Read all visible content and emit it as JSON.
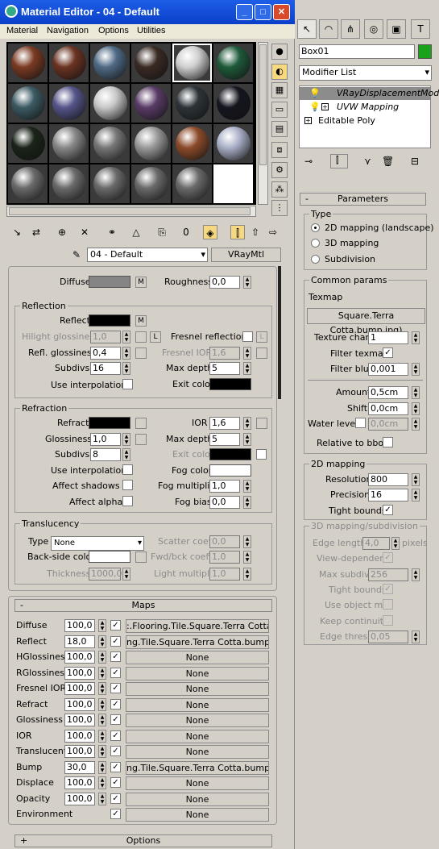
{
  "window": {
    "title": "Material Editor - 04 - Default",
    "minimize": "_",
    "maximize": "□",
    "close": "✕"
  },
  "menu": [
    "Material",
    "Navigation",
    "Options",
    "Utilities"
  ],
  "colors": {
    "title_blue": "#0a3fc9",
    "object_color": "#1aa31a",
    "selected_modifier": "#8c8c8c"
  },
  "slot_balls": [
    "#7a3a22",
    "#6b3322",
    "#4f6a85",
    "#3a2a24",
    "#cfcfcf",
    "#1e5a3a",
    "#3c5a63",
    "#55558a",
    "#c8c8c8",
    "#5a3b66",
    "#2c3438",
    "#15151f",
    "#1a2418",
    "#888888",
    "#777777",
    "#9a9a9a",
    "#8c4a2a",
    "#aab0c8",
    "#6a6a6a",
    "#6a6a6a",
    "#6a6a6a",
    "#6a6a6a",
    "#6a6a6a",
    "#ffffff"
  ],
  "material_name": "04 - Default",
  "material_type": "VRayMtl",
  "basic": {
    "diffuse": "Diffuse",
    "diffuse_btn": "M",
    "roughness": "Roughness",
    "roughness_val": "0,0"
  },
  "reflection": {
    "title": "Reflection",
    "reflect": "Reflect",
    "reflect_btn": "M",
    "hilight": "Hilight glossiness",
    "hilight_val": "1,0",
    "hilight_lock": "L",
    "fresnel": "Fresnel reflections",
    "fresnel_lock": "L",
    "refl_gloss": "Refl. glossiness",
    "refl_gloss_val": "0,4",
    "fresnel_ior": "Fresnel IOR",
    "fresnel_ior_val": "1,6",
    "subdivs": "Subdivs",
    "subdivs_val": "16",
    "max_depth": "Max depth",
    "max_depth_val": "5",
    "use_interp": "Use interpolation",
    "exit_color": "Exit color"
  },
  "refraction": {
    "title": "Refraction",
    "refract": "Refract",
    "ior": "IOR",
    "ior_val": "1,6",
    "glossiness": "Glossiness",
    "glossiness_val": "1,0",
    "max_depth": "Max depth",
    "max_depth_val": "5",
    "subdivs": "Subdivs",
    "subdivs_val": "8",
    "exit_color": "Exit color",
    "use_interp": "Use interpolation",
    "fog_color": "Fog color",
    "affect_shadows": "Affect shadows",
    "fog_mult": "Fog multiplier",
    "fog_mult_val": "1,0",
    "affect_alpha": "Affect alpha",
    "fog_bias": "Fog bias",
    "fog_bias_val": "0,0"
  },
  "translucency": {
    "title": "Translucency",
    "type": "Type",
    "type_val": "None",
    "scatter": "Scatter coeff",
    "scatter_val": "0,0",
    "backside": "Back-side color",
    "fwd": "Fwd/bck coeff",
    "fwd_val": "1,0",
    "thickness": "Thickness",
    "thickness_val": "1000,0",
    "light_mult": "Light multiplier",
    "light_mult_val": "1,0"
  },
  "maps": {
    "title": "Maps",
    "minus": "-",
    "rows": [
      {
        "name": "Diffuse",
        "amount": "100,0",
        "map": ":.Flooring.Tile.Square.Terra Cotta.jpg)"
      },
      {
        "name": "Reflect",
        "amount": "18,0",
        "map": "ng.Tile.Square.Terra Cotta.bump.jpg)"
      },
      {
        "name": "HGlossiness",
        "amount": "100,0",
        "map": "None"
      },
      {
        "name": "RGlossiness",
        "amount": "100,0",
        "map": "None"
      },
      {
        "name": "Fresnel IOR",
        "amount": "100,0",
        "map": "None"
      },
      {
        "name": "Refract",
        "amount": "100,0",
        "map": "None"
      },
      {
        "name": "Glossiness",
        "amount": "100,0",
        "map": "None"
      },
      {
        "name": "IOR",
        "amount": "100,0",
        "map": "None"
      },
      {
        "name": "Translucent",
        "amount": "100,0",
        "map": "None"
      },
      {
        "name": "Bump",
        "amount": "30,0",
        "map": "ng.Tile.Square.Terra Cotta.bump.jpg)"
      },
      {
        "name": "Displace",
        "amount": "100,0",
        "map": "None"
      },
      {
        "name": "Opacity",
        "amount": "100,0",
        "map": "None"
      },
      {
        "name": "Environment",
        "amount": "",
        "map": "None"
      }
    ]
  },
  "options": {
    "title": "Options",
    "plus": "+"
  },
  "cmd": {
    "object_name": "Box01",
    "modifier_list": "Modifier List",
    "stack": [
      "VRayDisplacementMod",
      "UVW Mapping",
      "Editable Poly"
    ],
    "params_title": "Parameters",
    "params_minus": "-",
    "type_title": "Type",
    "type_opts": [
      "2D mapping (landscape)",
      "3D mapping",
      "Subdivision"
    ],
    "common_title": "Common params",
    "texmap": "Texmap",
    "texmap_val": "Square.Terra Cotta.bump.jpg)",
    "texture_chan": "Texture chan",
    "texture_chan_val": "1",
    "filter_texmap": "Filter texmap",
    "filter_blur": "Filter blur",
    "filter_blur_val": "0,001",
    "amount": "Amount",
    "amount_val": "0,5cm",
    "shift": "Shift",
    "shift_val": "0,0cm",
    "water": "Water level",
    "water_val": "0,0cm",
    "relative": "Relative to bbox",
    "map2d_title": "2D mapping",
    "resolution": "Resolution",
    "resolution_val": "800",
    "precision": "Precision",
    "precision_val": "16",
    "tight": "Tight bounds",
    "map3d_title": "3D mapping/subdivision",
    "edge_len": "Edge length",
    "edge_len_val": "4,0",
    "pixels": "pixels",
    "view_dep": "View-dependent",
    "max_subdivs": "Max subdivs",
    "max_subdivs_val": "256",
    "tight3": "Tight bounds",
    "use_obj": "Use object mtl",
    "keep": "Keep continuity",
    "edge_thresh": "Edge thresh",
    "edge_thresh_val": "0,05"
  }
}
